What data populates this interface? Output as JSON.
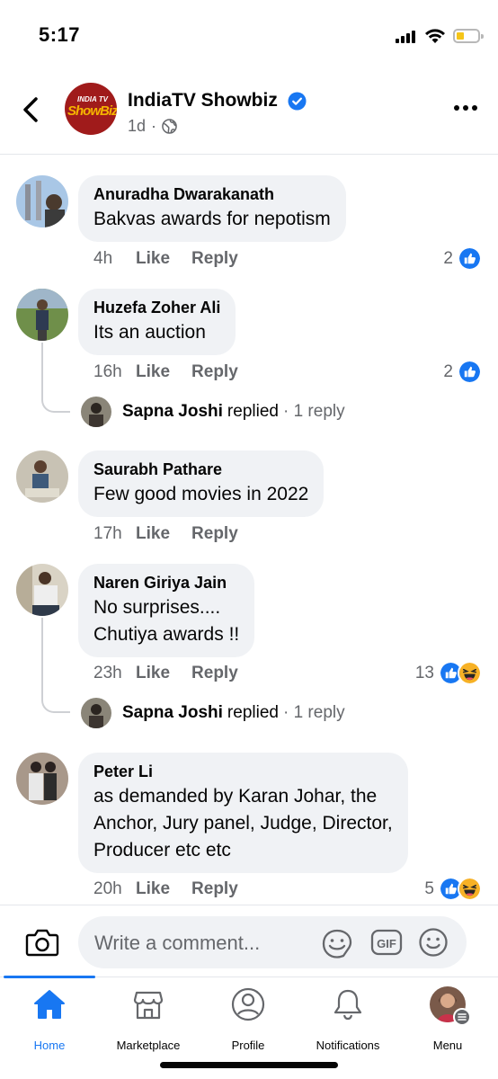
{
  "status": {
    "time": "5:17"
  },
  "header": {
    "page_name": "IndiaTV Showbiz",
    "post_age": "1d",
    "logo_top": "INDIA TV",
    "logo_main": "ShowBiz",
    "verified_color": "#1877f2"
  },
  "comments": [
    {
      "author": "Anuradha Dwarakanath",
      "text": "Bakvas awards for nepotism",
      "time": "4h",
      "like": "Like",
      "reply": "Reply",
      "reaction_count": "2",
      "reactions": [
        "like-icon"
      ]
    },
    {
      "author": "Huzefa Zoher Ali",
      "text": "Its an auction",
      "time": "16h",
      "like": "Like",
      "reply": "Reply",
      "reaction_count": "2",
      "reactions": [
        "like-icon"
      ],
      "replies": {
        "name": "Sapna Joshi",
        "verb": "replied",
        "count": "· 1 reply"
      }
    },
    {
      "author": "Saurabh Pathare",
      "text": "Few good movies in 2022",
      "time": "17h",
      "like": "Like",
      "reply": "Reply"
    },
    {
      "author": "Naren Giriya Jain",
      "text": "No surprises....\nChutiya awards !!",
      "time": "23h",
      "like": "Like",
      "reply": "Reply",
      "reaction_count": "13",
      "reactions": [
        "like-icon",
        "haha-icon"
      ],
      "replies": {
        "name": "Sapna Joshi",
        "verb": "replied",
        "count": "· 1 reply"
      }
    },
    {
      "author": "Peter Li",
      "text": "as demanded by Karan Johar, the\nAnchor, Jury panel, Judge, Director,\nProducer etc etc",
      "time": "20h",
      "like": "Like",
      "reply": "Reply",
      "reaction_count": "5",
      "reactions": [
        "like-icon",
        "haha-icon"
      ]
    }
  ],
  "composer": {
    "placeholder": "Write a comment...",
    "gif_label": "GIF"
  },
  "nav": {
    "items": [
      {
        "label": "Home",
        "icon": "home-icon",
        "active": true
      },
      {
        "label": "Marketplace",
        "icon": "marketplace-icon"
      },
      {
        "label": "Profile",
        "icon": "profile-icon"
      },
      {
        "label": "Notifications",
        "icon": "bell-icon"
      },
      {
        "label": "Menu",
        "icon": "menu-avatar"
      }
    ]
  },
  "colors": {
    "accent": "#1877f2",
    "bubble": "#f0f2f5",
    "secondary_text": "#65676b",
    "haha": "#f7b125"
  }
}
